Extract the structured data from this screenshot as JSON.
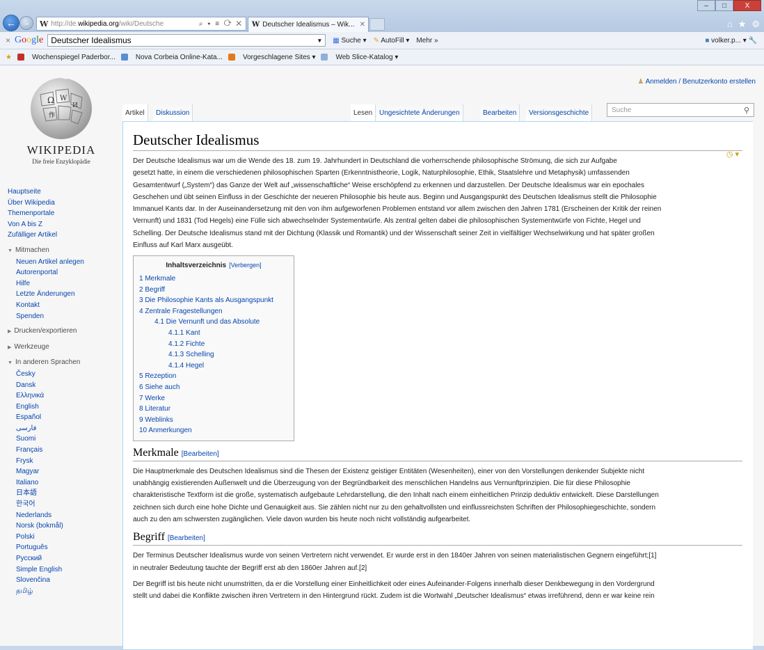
{
  "browser": {
    "address_url": "http://de.wikipedia.org/wiki/Deutsche",
    "address_domain": "wikipedia.org",
    "address_prefix": "http://de.",
    "address_suffix": "/wiki/Deutsche",
    "address_tools": "⌕ ▾ ≡ ⟳ ✕",
    "tab_title": "Deutscher Idealismus – Wik...",
    "tab_close": "✕",
    "favicon_letter": "W",
    "window_controls": [
      "–",
      "□",
      "X"
    ],
    "right_icons": [
      "⌂",
      "★",
      "⚙"
    ]
  },
  "google_toolbar": {
    "close": "×",
    "logo": "Google",
    "query": "Deutscher Idealismus",
    "items": [
      "Suche ▾",
      "AutoFill ▾",
      "Mehr »"
    ],
    "user": "volker.p... ▾"
  },
  "favorites": [
    "Wochenspiegel Paderbor...",
    "Nova Corbeia Online-Kata...",
    "Vorgeschlagene Sites ▾",
    "Web Slice-Katalog ▾"
  ],
  "wiki": {
    "wordmark": "Wikipedia",
    "tagline": "Die freie Enzyklopädie",
    "top_links": "Anmelden / Benutzerkonto erstellen",
    "portal": [
      "Hauptseite",
      "Über Wikipedia",
      "Themenportale",
      "Von A bis Z",
      "Zufälliger Artikel"
    ],
    "mitmachen_title": "Mitmachen",
    "mitmachen": [
      "Neuen Artikel anlegen",
      "Autorenportal",
      "Hilfe",
      "Letzte Änderungen",
      "Kontakt",
      "Spenden"
    ],
    "drucken": "Drucken/exportieren",
    "werkzeuge": "Werkzeuge",
    "sprachen_title": "In anderen Sprachen",
    "sprachen": [
      "Česky",
      "Dansk",
      "Ελληνικά",
      "English",
      "Español",
      "فارسی",
      "Suomi",
      "Français",
      "Frysk",
      "Magyar",
      "Italiano",
      "日本語",
      "한국어",
      "Nederlands",
      "Norsk (bokmål)",
      "Polski",
      "Português",
      "Русский",
      "Simple English",
      "Slovenčina",
      "தமிழ்"
    ],
    "tabs_left": [
      "Artikel",
      "Diskussion"
    ],
    "tabs_right": [
      "Lesen",
      "Ungesichtete Änderungen",
      "Bearbeiten",
      "Versionsgeschichte"
    ],
    "search_placeholder": "Suche",
    "title": "Deutscher Idealismus",
    "intro_lines": [
      "Der Deutsche Idealismus war um die Wende des 18. zum 19. Jahrhundert in Deutschland die vorherrschende philosophische Strömung, die sich zur Aufgabe",
      "gesetzt hatte, in einem die verschiedenen philosophischen Sparten (Erkenntnistheorie, Logik, Naturphilosophie, Ethik, Staatslehre und Metaphysik) umfassenden",
      "Gesamtentwurf („System“) das Ganze der Welt auf „wissenschaftliche“ Weise erschöpfend zu erkennen und darzustellen. Der Deutsche Idealismus war ein epochales",
      "Geschehen und übt seinen Einfluss in der Geschichte der neueren Philosophie bis heute aus. Beginn und Ausgangspunkt des Deutschen Idealismus stellt die Philosophie",
      "Immanuel Kants dar. In der Auseinandersetzung mit den von ihm aufgeworfenen Problemen entstand vor allem zwischen den Jahren 1781 (Erscheinen der Kritik der reinen",
      "Vernunft) und 1831 (Tod Hegels) eine Fülle sich abwechselnder Systementwürfe. Als zentral gelten dabei die philosophischen Systementwürfe von Fichte, Hegel und",
      "Schelling. Der Deutsche Idealismus stand mit der Dichtung (Klassik und Romantik) und der Wissenschaft seiner Zeit in vielfältiger Wechselwirkung und hat später großen",
      "Einfluss auf Karl Marx ausgeübt."
    ],
    "toc_title": "Inhaltsverzeichnis",
    "toc_hide": "[Verbergen]",
    "toc": [
      {
        "t": "1 Merkmale",
        "l": 1
      },
      {
        "t": "2 Begriff",
        "l": 1
      },
      {
        "t": "3 Die Philosophie Kants als Ausgangspunkt",
        "l": 1
      },
      {
        "t": "4 Zentrale Fragestellungen",
        "l": 1
      },
      {
        "t": "4.1 Die Vernunft und das Absolute",
        "l": 2
      },
      {
        "t": "4.1.1 Kant",
        "l": 3
      },
      {
        "t": "4.1.2 Fichte",
        "l": 3
      },
      {
        "t": "4.1.3 Schelling",
        "l": 3
      },
      {
        "t": "4.1.4 Hegel",
        "l": 3
      },
      {
        "t": "5 Rezeption",
        "l": 1
      },
      {
        "t": "6 Siehe auch",
        "l": 1
      },
      {
        "t": "7 Werke",
        "l": 1
      },
      {
        "t": "8 Literatur",
        "l": 1
      },
      {
        "t": "9 Weblinks",
        "l": 1
      },
      {
        "t": "10 Anmerkungen",
        "l": 1
      }
    ],
    "h_merkmale": "Merkmale",
    "edit": "[Bearbeiten]",
    "merkmale_lines": [
      "Die Hauptmerkmale des Deutschen Idealismus sind die Thesen der Existenz geistiger Entitäten (Wesenheiten), einer von den Vorstellungen denkender Subjekte nicht",
      "unabhängig existierenden Außenwelt und die Überzeugung von der Begründbarkeit des menschlichen Handelns aus Vernunftprinzipien. Die für diese Philosophie",
      "charakteristische Textform ist die große, systematisch aufgebaute Lehrdarstellung, die den Inhalt nach einem einheitlichen Prinzip deduktiv entwickelt. Diese Darstellungen",
      "zeichnen sich durch eine hohe Dichte und Genauigkeit aus. Sie zählen nicht nur zu den gehaltvollsten und einflussreichsten Schriften der Philosophiegeschichte, sondern",
      "auch zu den am schwersten zugänglichen. Viele davon wurden bis heute noch nicht vollständig aufgearbeitet."
    ],
    "h_begriff": "Begriff",
    "begriff_lines": [
      "Der Terminus Deutscher Idealismus wurde von seinen Vertretern nicht verwendet. Er wurde erst in den 1840er Jahren von seinen materialistischen Gegnern eingeführt;[1]",
      "in neutraler Bedeutung tauchte der Begriff erst ab den 1860er Jahren auf.[2]"
    ],
    "begriff2_lines": [
      "Der Begriff ist bis heute nicht unumstritten, da er die Vorstellung einer Einheitlichkeit oder eines Aufeinander-Folgens innerhalb dieser Denkbewegung in den Vordergrund",
      "stellt und dabei die Konflikte zwischen ihren Vertretern in den Hintergrund rückt. Zudem ist die Wortwahl „Deutscher Idealismus“ etwas irreführend, denn er war keine rein"
    ]
  }
}
